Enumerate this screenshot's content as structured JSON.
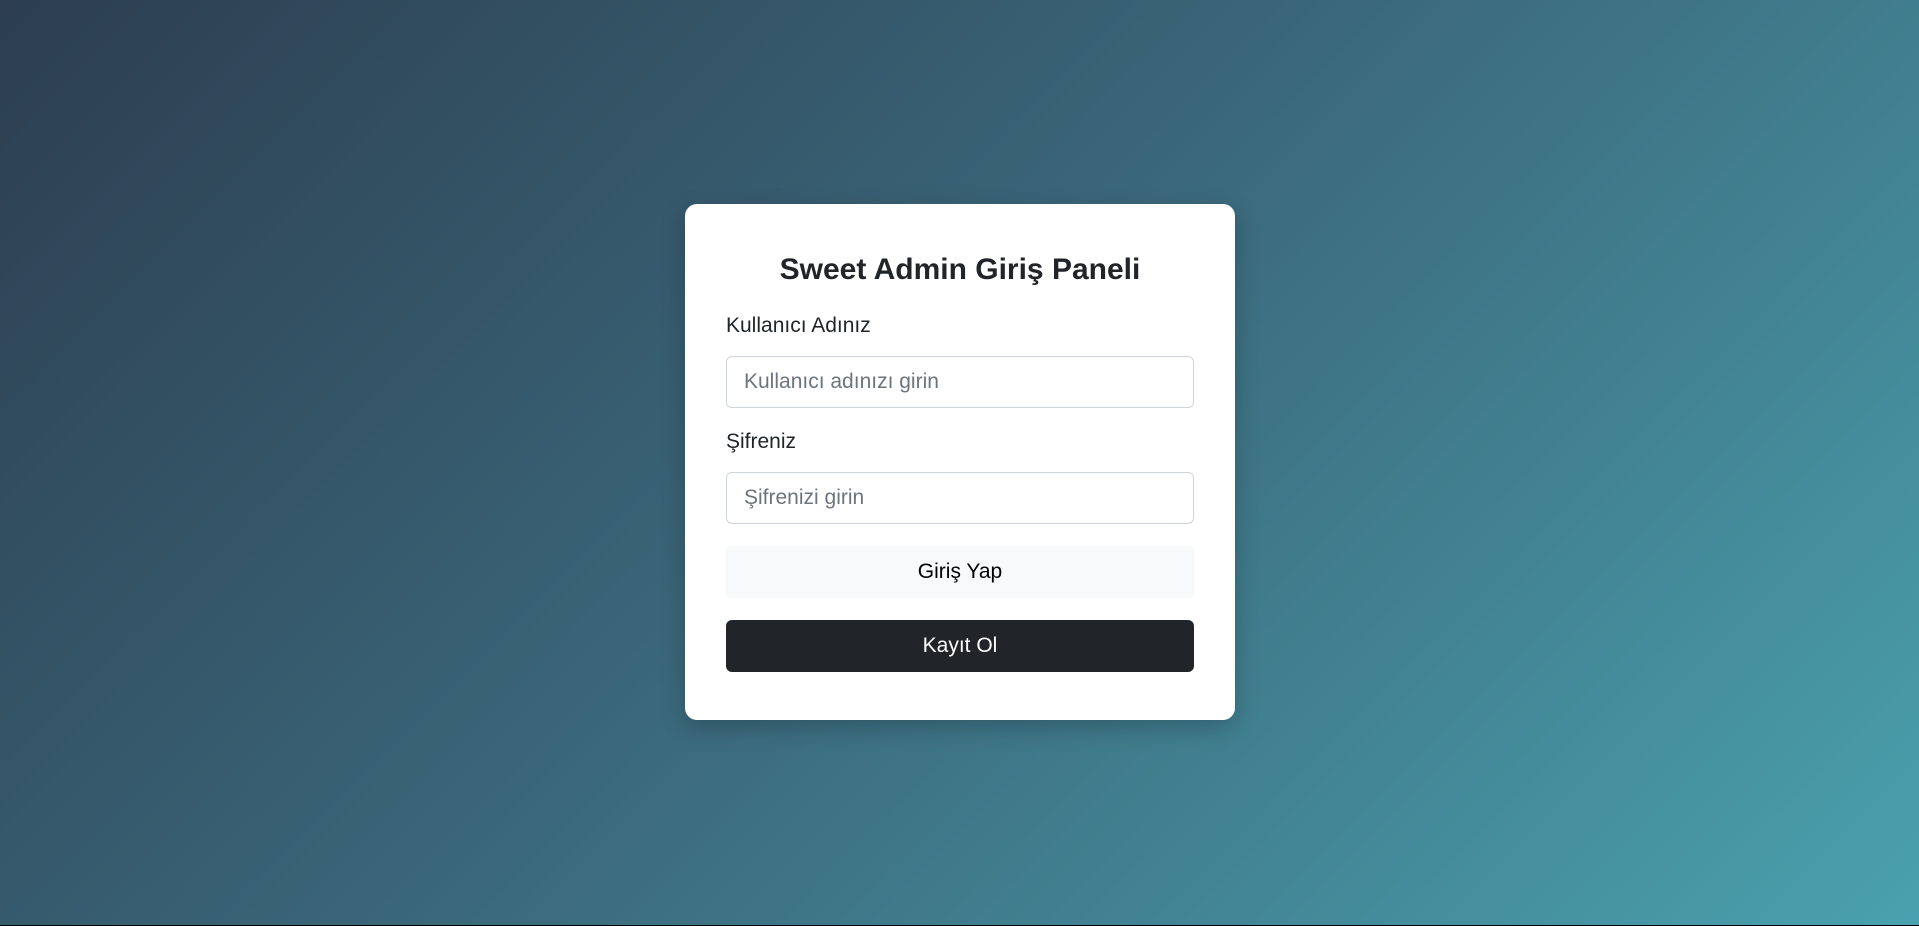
{
  "colors": {
    "background_gradient_start": "#2c3e50",
    "background_gradient_end": "#4aa1ae",
    "card_background": "#ffffff",
    "primary_button": "#212529",
    "secondary_button": "#f8f9fa"
  },
  "login_panel": {
    "title": "Sweet Admin Giriş Paneli",
    "username": {
      "label": "Kullanıcı Adınız",
      "value": "",
      "placeholder": "Kullanıcı adınızı girin"
    },
    "password": {
      "label": "Şifreniz",
      "value": "",
      "placeholder": "Şifrenizi girin"
    },
    "login_button_label": "Giriş Yap",
    "register_button_label": "Kayıt Ol"
  }
}
